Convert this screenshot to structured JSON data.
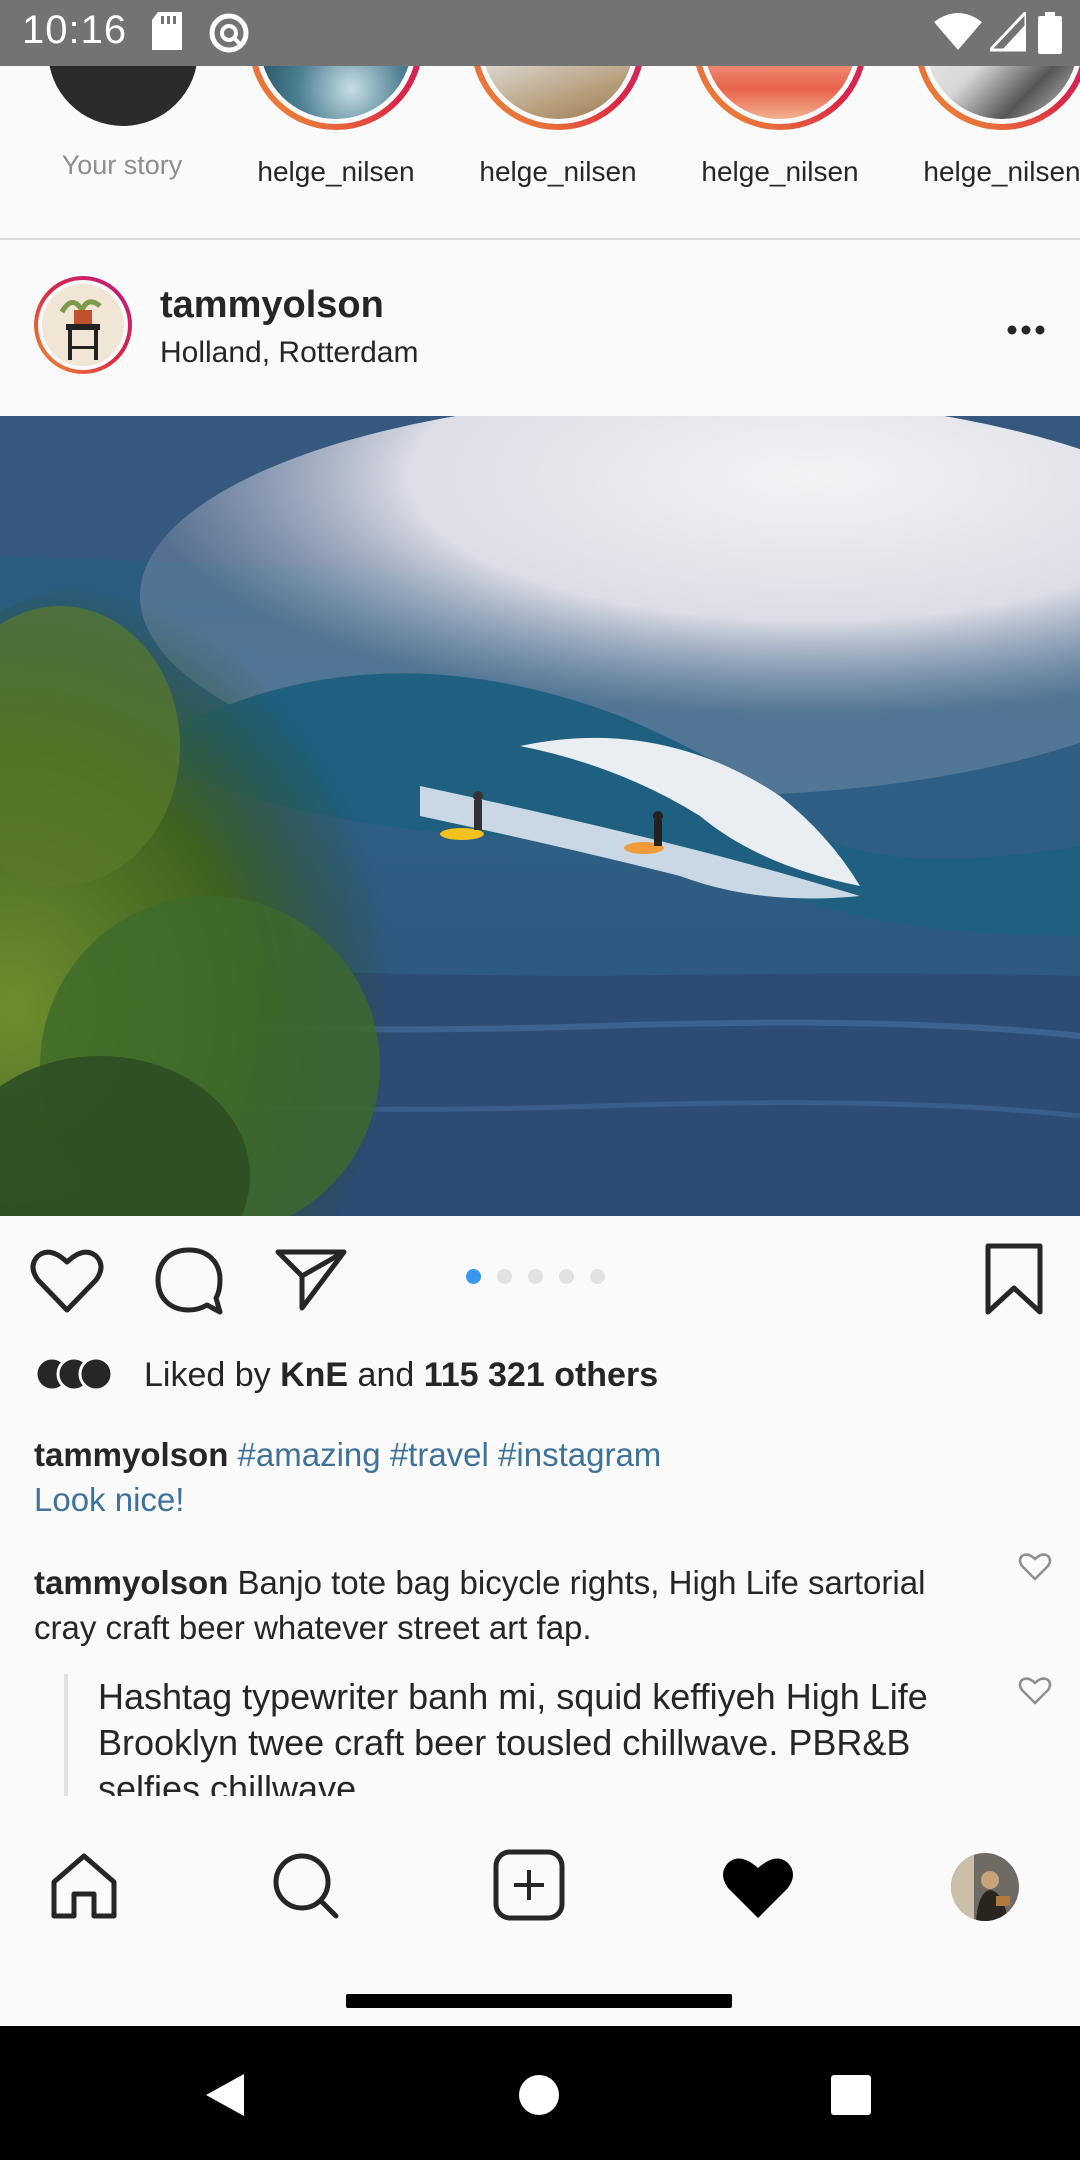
{
  "status_bar": {
    "time": "10:16",
    "icons": [
      "sd-card-icon",
      "at-sync-icon",
      "wifi-icon",
      "signal-icon",
      "battery-icon"
    ]
  },
  "stories": {
    "your_story_label": "Your story",
    "items": [
      {
        "username": "helge_nilsen"
      },
      {
        "username": "helge_nilsen"
      },
      {
        "username": "helge_nilsen"
      },
      {
        "username": "helge_nilsen"
      }
    ]
  },
  "post": {
    "username": "tammyolson",
    "location": "Holland, Rotterdam",
    "carousel": {
      "current": 1,
      "total": 5
    },
    "likes": {
      "prefix": "Liked by ",
      "liked_by": "KnE",
      "conjunction": " and ",
      "others": "115 321 others"
    },
    "caption": {
      "username": "tammyolson",
      "hashtags": [
        "#amazing",
        "#travel",
        "#instagram"
      ],
      "text": "Look nice!"
    },
    "comments": [
      {
        "username": "tammyolson",
        "text": "Banjo tote bag bicycle rights, High Life sartorial cray craft beer whatever street art fap."
      }
    ],
    "reply": {
      "text": "Hashtag typewriter banh mi, squid keffiyeh High Life Brooklyn twee craft beer tousled chillwave. PBR&B selfies chillwave"
    }
  },
  "bottom_nav": {
    "items": [
      "home-icon",
      "search-icon",
      "add-post-icon",
      "activity-heart-icon",
      "profile-avatar"
    ],
    "active": "activity-heart-icon"
  },
  "colors": {
    "status_bar": "#737373",
    "hashtag": "#3f729b",
    "active_dot": "#3897f0",
    "story_ring_start": "#f09433",
    "story_ring_end": "#bc1888"
  }
}
